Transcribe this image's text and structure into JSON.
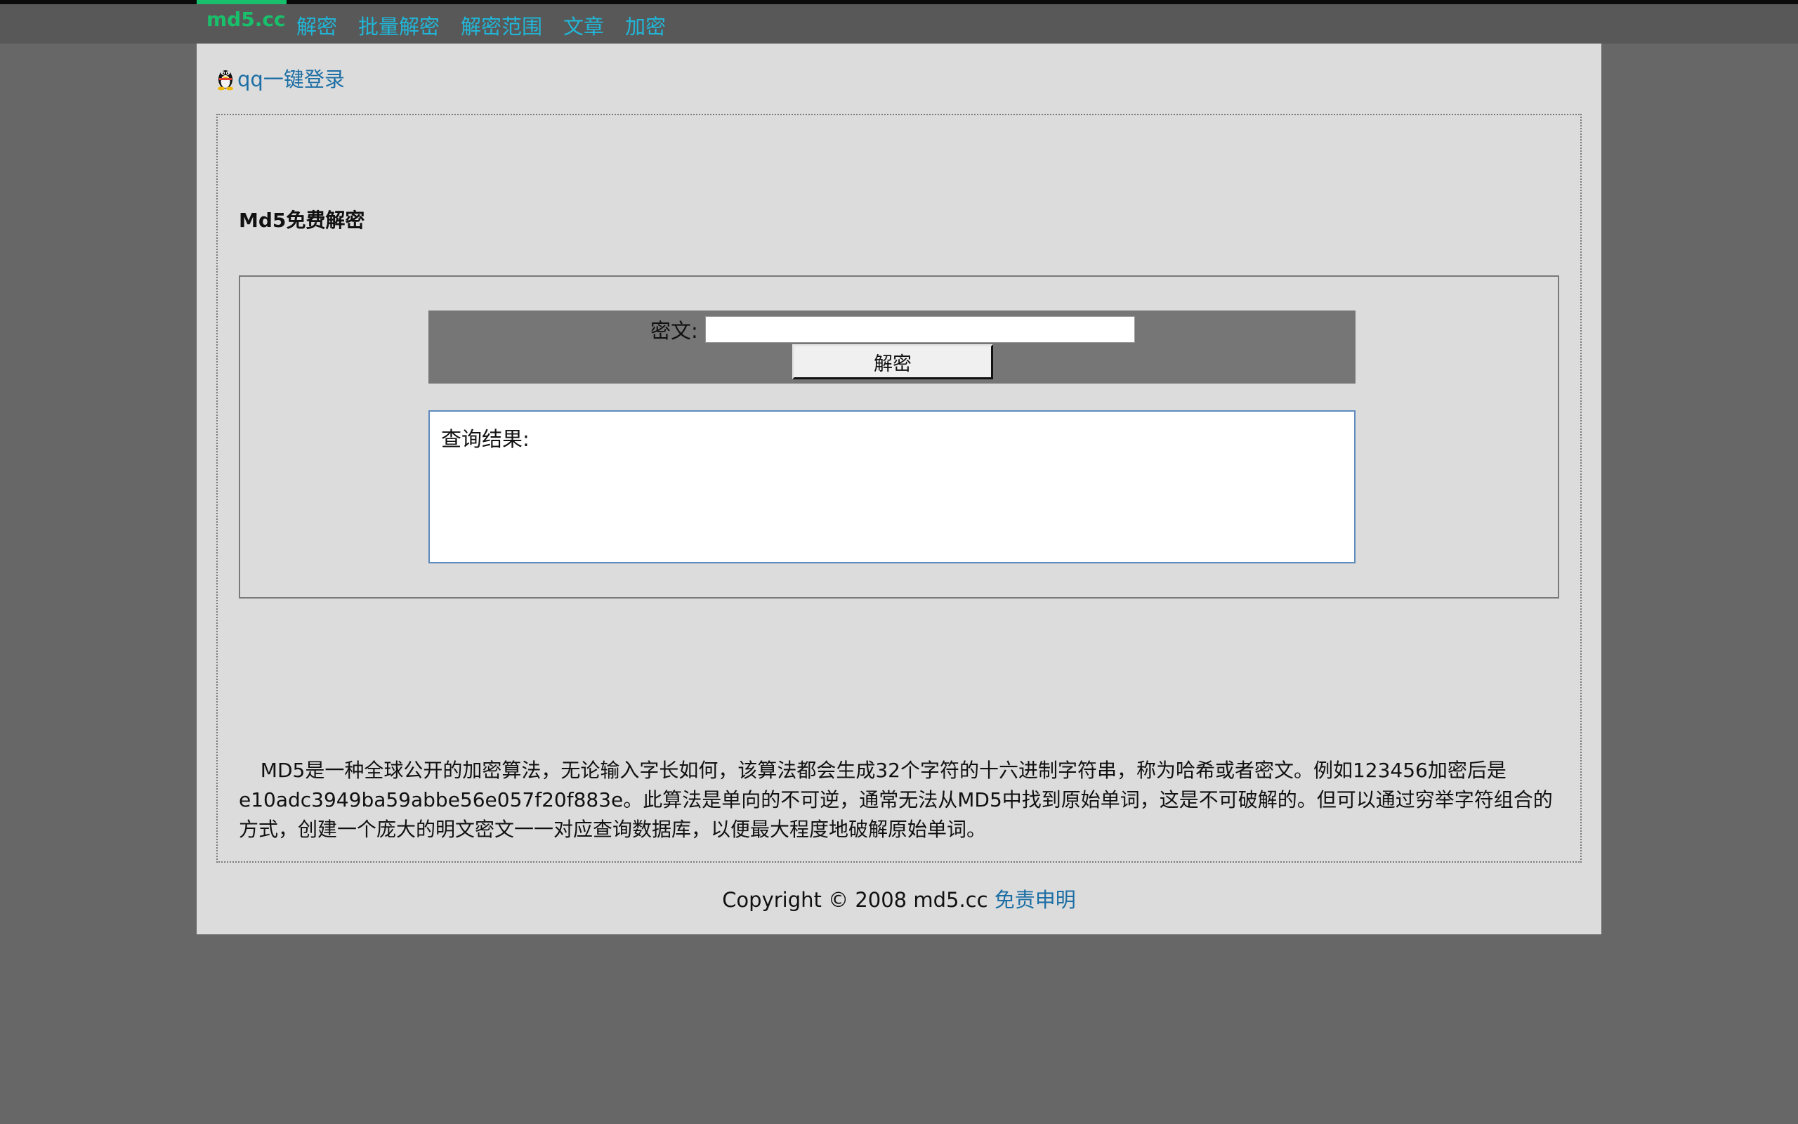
{
  "nav": {
    "brand": "md5.cc",
    "items": [
      {
        "label": "解密"
      },
      {
        "label": "批量解密"
      },
      {
        "label": "解密范围"
      },
      {
        "label": "文章"
      },
      {
        "label": "加密"
      }
    ]
  },
  "login": {
    "icon": "qq-penguin-icon",
    "label": "qq一键登录"
  },
  "main": {
    "title": "Md5免费解密",
    "cipher_label": "密文:",
    "cipher_value": "",
    "decrypt_button": "解密",
    "result_label": "查询结果:",
    "description": "MD5是一种全球公开的加密算法，无论输入字长如何，该算法都会生成32个字符的十六进制字符串，称为哈希或者密文。例如123456加密后是e10adc3949ba59abbe56e057f20f883e。此算法是单向的不可逆，通常无法从MD5中找到原始单词，这是不可破解的。但可以通过穷举字符组合的方式，创建一个庞大的明文密文一一对应查询数据库，以便最大程度地破解原始单词。"
  },
  "footer": {
    "copyright": "Copyright © 2008 md5.cc",
    "disclaimer": "免责申明"
  },
  "colors": {
    "brand": "#19c06b",
    "nav_link": "#21b6d7",
    "link": "#1c6ea4",
    "background": "#676767",
    "panel": "#dcdcdc"
  }
}
